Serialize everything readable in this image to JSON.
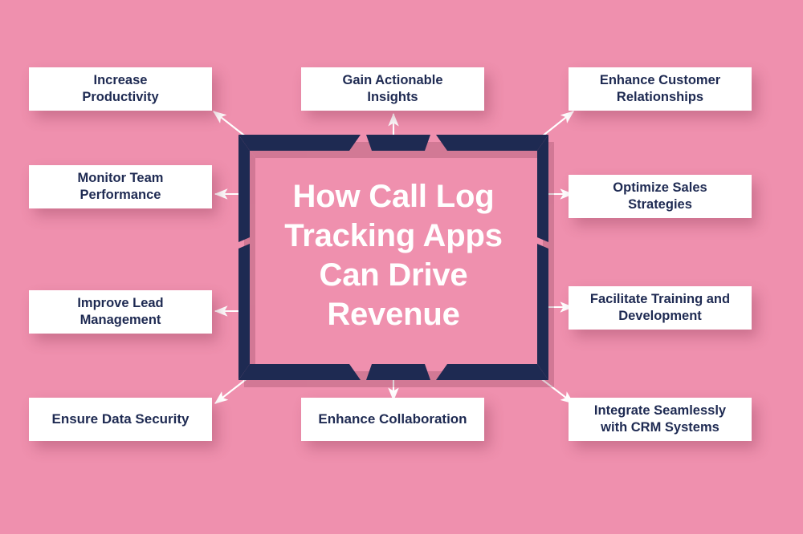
{
  "theme": {
    "background": "#ef90ae",
    "frame_navy": "#1e2a52",
    "card_background": "#ffffff",
    "card_text": "#1e2a52",
    "center_text": "#ffffff",
    "connector": "#ffffff"
  },
  "center": {
    "title": "How Call Log\nTracking Apps\nCan Drive\nRevenue",
    "title_flat": "How Call Log Tracking Apps Can Drive Revenue"
  },
  "nodes": [
    {
      "id": "increase-productivity",
      "label": "Increase\nProductivity",
      "label_flat": "Increase Productivity",
      "position": "top-left",
      "arrow": "diagonal-up-left"
    },
    {
      "id": "gain-actionable-insights",
      "label": "Gain Actionable\nInsights",
      "label_flat": "Gain Actionable Insights",
      "position": "top-center",
      "arrow": "up"
    },
    {
      "id": "enhance-customer-relationships",
      "label": "Enhance Customer\nRelationships",
      "label_flat": "Enhance Customer Relationships",
      "position": "top-right",
      "arrow": "diagonal-up-right"
    },
    {
      "id": "monitor-team-performance",
      "label": "Monitor Team\nPerformance",
      "label_flat": "Monitor Team Performance",
      "position": "middle-left-upper",
      "arrow": "left"
    },
    {
      "id": "optimize-sales-strategies",
      "label": "Optimize Sales\nStrategies",
      "label_flat": "Optimize Sales Strategies",
      "position": "middle-right-upper",
      "arrow": "right"
    },
    {
      "id": "improve-lead-management",
      "label": "Improve Lead\nManagement",
      "label_flat": "Improve Lead Management",
      "position": "middle-left-lower",
      "arrow": "left"
    },
    {
      "id": "facilitate-training-and-development",
      "label": "Facilitate Training and\nDevelopment",
      "label_flat": "Facilitate Training and Development",
      "position": "middle-right-lower",
      "arrow": "right"
    },
    {
      "id": "ensure-data-security",
      "label": "Ensure Data Security",
      "label_flat": "Ensure Data Security",
      "position": "bottom-left",
      "arrow": "diagonal-down-left"
    },
    {
      "id": "enhance-collaboration",
      "label": "Enhance Collaboration",
      "label_flat": "Enhance Collaboration",
      "position": "bottom-center",
      "arrow": "down"
    },
    {
      "id": "integrate-seamlessly-with-crm-systems",
      "label": "Integrate Seamlessly\nwith CRM Systems",
      "label_flat": "Integrate Seamlessly with CRM Systems",
      "position": "bottom-right",
      "arrow": "diagonal-down-right"
    }
  ]
}
